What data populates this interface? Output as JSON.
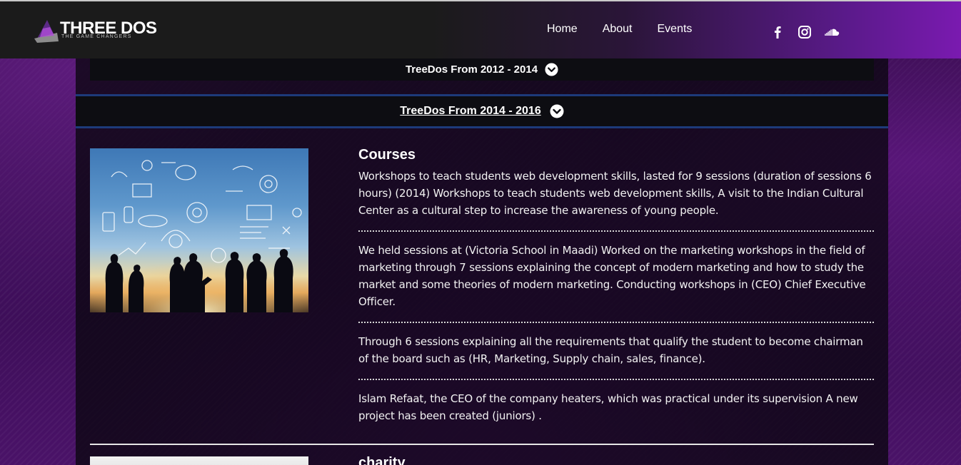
{
  "brand": {
    "name": "THREE DOS",
    "tagline": "THE GAME CHANGERS"
  },
  "nav": {
    "items": [
      "Home",
      "About",
      "Events"
    ]
  },
  "social": [
    "facebook-icon",
    "instagram-icon",
    "soundcloud-icon"
  ],
  "accordion": [
    {
      "label": "TreeDos From 2012 - 2014"
    },
    {
      "label": "TreeDos From 2014 - 2016"
    }
  ],
  "courses": {
    "title": "Courses",
    "paragraphs": [
      "Workshops to teach students web development skills, lasted for 9 sessions (duration of sessions 6 hours) (2014) Workshops to teach students web development skills, A visit to the Indian Cultural Center as a cultural step to increase the awareness of young people.",
      "We held sessions at (Victoria School in Maadi) Worked on the marketing workshops in the field of marketing through 7 sessions explaining the concept of modern marketing and how to study the market and some theories of modern marketing. Conducting workshops in (CEO) Chief Executive Officer.",
      "Through 6 sessions explaining all the requirements that qualify the student to become chairman of the board such as (HR, Marketing, Supply chain, sales, finance).",
      "Islam Refaat, the CEO of the company heaters, which was practical under its supervision A new project has been created (juniors) ."
    ]
  },
  "charity": {
    "title": "charity"
  },
  "colors": {
    "accent": "#7a1ab0",
    "divider_blue": "#1d3a7a",
    "nav_bg": "#1b1b1b"
  }
}
